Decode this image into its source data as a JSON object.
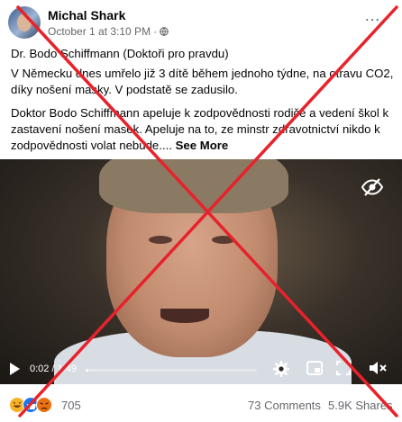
{
  "post": {
    "author": "Michal Shark",
    "date": "October 1 at 3:10 PM",
    "dot": "·",
    "more_icon": "…",
    "line1": "Dr. Bodo Schiffmann (Doktoři pro pravdu)",
    "line2": "V Německu dnes umřelo již 3 dítě během jednoho týdne, na otravu CO2, díky nošení masky. V podstatě se zadusilo.",
    "line3": "Doktor Bodo Schiffmann apeluje k zodpovědnosti rodiče a vedení škol k zastavení  nošení masek. Apeluje na to, ze minstr zdravotnictví nikdo k zodpovědnosti volat nebude....",
    "see_more": "See More"
  },
  "video": {
    "time": "0:02 / 1:49",
    "progress": 0.018
  },
  "footer": {
    "reaction_count": "705",
    "comments": "73 Comments",
    "shares": "5.9K Shares"
  },
  "colors": {
    "cross": "#e8222b",
    "meta": "#65676b"
  },
  "icons": [
    "globe-icon",
    "more-icon",
    "eye-off-icon",
    "play-icon",
    "volume-icon",
    "settings-icon",
    "pip-icon",
    "fullscreen-icon",
    "mute-icon",
    "angry-reaction-icon",
    "like-reaction-icon",
    "haha-reaction-icon"
  ]
}
